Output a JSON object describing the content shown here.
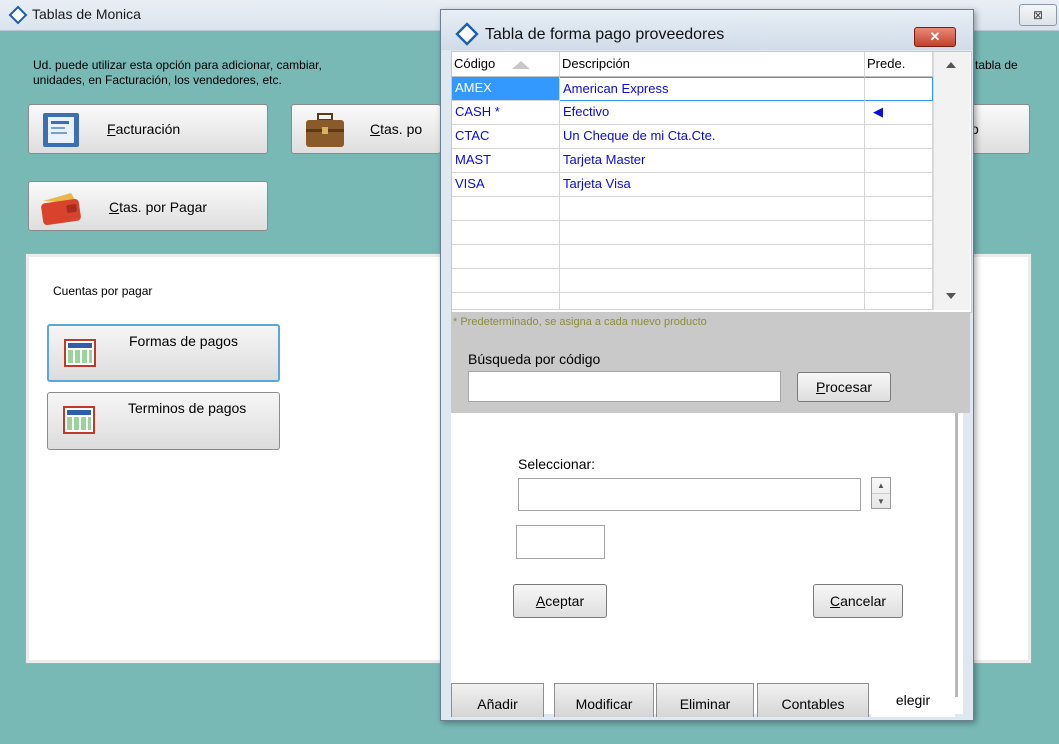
{
  "main_window": {
    "title": "Tablas de Monica",
    "close_glyph": "⊠",
    "description_line1": "Ud. puede utilizar esta opción para adicionar, cambiar,",
    "description_line1_right": "tabla de",
    "description_line2": "unidades, en Facturación, los vendedores, etc.",
    "buttons": {
      "facturacion": "acturación",
      "facturacion_mnemonic": "F",
      "ctas_por_cobrar_partial": "tas. po",
      "ctas_por_cobrar_mnemonic": "C",
      "ctas_por_cobrar_prefix": "",
      "right_partial": "o",
      "ctas_por_pagar": "tas. por Pagar",
      "ctas_por_pagar_mnemonic": "C"
    },
    "panel": {
      "title": "Cuentas por pagar",
      "formas_de_pagos": "Formas de pagos",
      "terminos_de_pagos": "Terminos de pagos"
    }
  },
  "dialog": {
    "title": "Tabla de forma pago proveedores",
    "close_glyph": "✕",
    "columns": [
      "Código",
      "Descripción",
      "Prede."
    ],
    "rows": [
      {
        "codigo": "AMEX",
        "descripcion": "American Express",
        "prede": ""
      },
      {
        "codigo": "CASH *",
        "descripcion": "Efectivo",
        "prede": "◀"
      },
      {
        "codigo": "CTAC",
        "descripcion": "Un Cheque de mi Cta.Cte.",
        "prede": ""
      },
      {
        "codigo": "MAST",
        "descripcion": "Tarjeta Master",
        "prede": ""
      },
      {
        "codigo": "VISA",
        "descripcion": "Tarjeta Visa",
        "prede": ""
      }
    ],
    "selected_row": 0,
    "empty_rows": 5,
    "footnote": "* Predeterminado,  se asigna a cada nuevo producto",
    "search_label": "Búsqueda por código",
    "search_value": "",
    "procesar_mnemonic": "P",
    "procesar_rest": "rocesar",
    "select_label": "Seleccionar:",
    "select_value": "",
    "small_value": "",
    "aceptar_mnemonic": "A",
    "aceptar_rest": "ceptar",
    "cancelar_mnemonic": "C",
    "cancelar_rest": "ancelar",
    "tabs": [
      "Añadir",
      "Modificar",
      "Eliminar",
      "Contables",
      "elegir"
    ],
    "active_tab": "elegir"
  },
  "colors": {
    "background": "#78b9b6",
    "selection": "#3399ff",
    "row_text": "#0a0ad9",
    "close_red": "#c2412b"
  },
  "icons": [
    "diamond-window-icon",
    "invoice-icon",
    "briefcase-icon",
    "wallet-icon",
    "grid-table-icon",
    "sort-ascending-icon",
    "row-pointer-icon",
    "scroll-up-icon",
    "scroll-down-icon",
    "spin-up-icon",
    "spin-down-icon"
  ]
}
